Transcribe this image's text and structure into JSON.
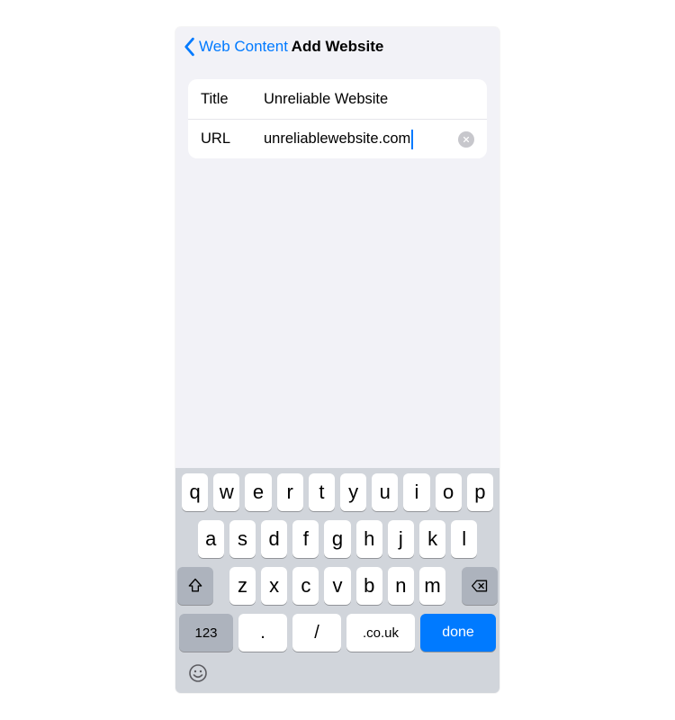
{
  "nav": {
    "back_label": "Web Content",
    "title": "Add Website"
  },
  "form": {
    "title_label": "Title",
    "title_value": "Unreliable Website",
    "url_label": "URL",
    "url_value": "unreliablewebsite.com"
  },
  "keyboard": {
    "row1": [
      "q",
      "w",
      "e",
      "r",
      "t",
      "y",
      "u",
      "i",
      "o",
      "p"
    ],
    "row2": [
      "a",
      "s",
      "d",
      "f",
      "g",
      "h",
      "j",
      "k",
      "l"
    ],
    "row3": [
      "z",
      "x",
      "c",
      "v",
      "b",
      "n",
      "m"
    ],
    "k123": "123",
    "kdot": ".",
    "kslash": "/",
    "kcouk": ".co.uk",
    "kdone": "done"
  },
  "colors": {
    "accent": "#007aff",
    "bg": "#f2f2f7",
    "key_special": "#adb3bd"
  }
}
